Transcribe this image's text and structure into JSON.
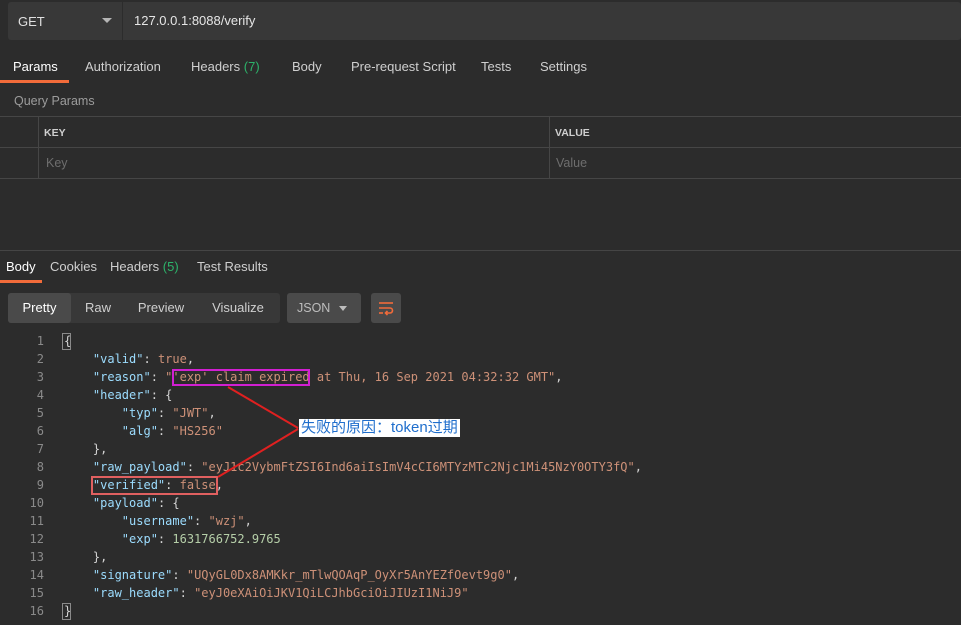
{
  "request": {
    "method": "GET",
    "url": "127.0.0.1:8088/verify"
  },
  "request_tabs": [
    {
      "label": "Params",
      "active": true
    },
    {
      "label": "Authorization"
    },
    {
      "label": "Headers",
      "count": "(7)"
    },
    {
      "label": "Body"
    },
    {
      "label": "Pre-request Script"
    },
    {
      "label": "Tests"
    },
    {
      "label": "Settings"
    }
  ],
  "query_params": {
    "section_label": "Query Params",
    "key_header": "KEY",
    "value_header": "VALUE",
    "key_placeholder": "Key",
    "value_placeholder": "Value"
  },
  "response_tabs": [
    {
      "label": "Body",
      "active": true
    },
    {
      "label": "Cookies"
    },
    {
      "label": "Headers",
      "count": "(5)"
    },
    {
      "label": "Test Results"
    }
  ],
  "view_modes": [
    "Pretty",
    "Raw",
    "Preview",
    "Visualize"
  ],
  "active_view": "Pretty",
  "format": "JSON",
  "code_lines": [
    {
      "n": "1",
      "tokens": [
        [
          "p",
          "{"
        ]
      ]
    },
    {
      "n": "2",
      "tokens": [
        [
          "p",
          "    "
        ],
        [
          "k",
          "\"valid\""
        ],
        [
          "p",
          ": "
        ],
        [
          "b",
          "true"
        ],
        [
          "p",
          ","
        ]
      ]
    },
    {
      "n": "3",
      "tokens": [
        [
          "p",
          "    "
        ],
        [
          "k",
          "\"reason\""
        ],
        [
          "p",
          ": "
        ],
        [
          "s",
          "\"'exp' claim expired at Thu, 16 Sep 2021 04:32:32 GMT\""
        ],
        [
          "p",
          ","
        ]
      ]
    },
    {
      "n": "4",
      "tokens": [
        [
          "p",
          "    "
        ],
        [
          "k",
          "\"header\""
        ],
        [
          "p",
          ": {"
        ]
      ]
    },
    {
      "n": "5",
      "tokens": [
        [
          "p",
          "        "
        ],
        [
          "k",
          "\"typ\""
        ],
        [
          "p",
          ": "
        ],
        [
          "s",
          "\"JWT\""
        ],
        [
          "p",
          ","
        ]
      ]
    },
    {
      "n": "6",
      "tokens": [
        [
          "p",
          "        "
        ],
        [
          "k",
          "\"alg\""
        ],
        [
          "p",
          ": "
        ],
        [
          "s",
          "\"HS256\""
        ]
      ]
    },
    {
      "n": "7",
      "tokens": [
        [
          "p",
          "    },"
        ]
      ]
    },
    {
      "n": "8",
      "tokens": [
        [
          "p",
          "    "
        ],
        [
          "k",
          "\"raw_payload\""
        ],
        [
          "p",
          ": "
        ],
        [
          "s",
          "\"eyJ1c2VybmFtZSI6Ind6aiIsImV4cCI6MTYzMTc2Njc1Mi45NzY0OTY3fQ\""
        ],
        [
          "p",
          ","
        ]
      ]
    },
    {
      "n": "9",
      "tokens": [
        [
          "p",
          "    "
        ],
        [
          "k",
          "\"verified\""
        ],
        [
          "p",
          ": "
        ],
        [
          "b",
          "false"
        ],
        [
          "p",
          ","
        ]
      ]
    },
    {
      "n": "10",
      "tokens": [
        [
          "p",
          "    "
        ],
        [
          "k",
          "\"payload\""
        ],
        [
          "p",
          ": {"
        ]
      ]
    },
    {
      "n": "11",
      "tokens": [
        [
          "p",
          "        "
        ],
        [
          "k",
          "\"username\""
        ],
        [
          "p",
          ": "
        ],
        [
          "s",
          "\"wzj\""
        ],
        [
          "p",
          ","
        ]
      ]
    },
    {
      "n": "12",
      "tokens": [
        [
          "p",
          "        "
        ],
        [
          "k",
          "\"exp\""
        ],
        [
          "p",
          ": "
        ],
        [
          "n",
          "1631766752.9765"
        ]
      ]
    },
    {
      "n": "13",
      "tokens": [
        [
          "p",
          "    },"
        ]
      ]
    },
    {
      "n": "14",
      "tokens": [
        [
          "p",
          "    "
        ],
        [
          "k",
          "\"signature\""
        ],
        [
          "p",
          ": "
        ],
        [
          "s",
          "\"UQyGL0Dx8AMKkr_mTlwQOAqP_OyXr5AnYEZfOevt9g0\""
        ],
        [
          "p",
          ","
        ]
      ]
    },
    {
      "n": "15",
      "tokens": [
        [
          "p",
          "    "
        ],
        [
          "k",
          "\"raw_header\""
        ],
        [
          "p",
          ": "
        ],
        [
          "s",
          "\"eyJ0eXAiOiJKV1QiLCJhbGciOiJIUzI1NiJ9\""
        ]
      ]
    },
    {
      "n": "16",
      "tokens": [
        [
          "p",
          "}"
        ]
      ]
    }
  ],
  "annotation": {
    "text": "失败的原因：token过期",
    "box_color_reason": "#d21fd2",
    "box_color_verified": "#e06060",
    "arrow_color": "#e02020"
  },
  "colors": {
    "accent": "#f26b3a",
    "count": "#2cb36a"
  }
}
